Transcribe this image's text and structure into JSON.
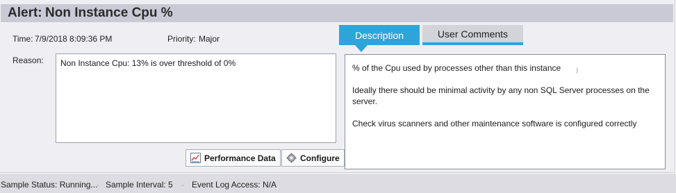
{
  "alert": {
    "prefix": "Alert:",
    "name": "Non Instance Cpu %"
  },
  "details": {
    "time_label": "Time:",
    "time_value": "7/9/2018 8:09:36 PM",
    "priority_label": "Priority:",
    "priority_value": "Major",
    "reason_label": "Reason:",
    "reason_text": "Non Instance Cpu: 13% is over threshold of 0%"
  },
  "buttons": {
    "performance_data": "Performance Data",
    "configure": "Configure"
  },
  "tabs": [
    {
      "label": "Description",
      "active": true
    },
    {
      "label": "User Comments",
      "active": false
    }
  ],
  "description": {
    "para1": "% of the Cpu used by processes other than this instance",
    "para2": "Ideally there should be minimal activity by any non SQL Server processes on the server.",
    "para3": "Check virus scanners and other maintenance software is configured correctly"
  },
  "status": {
    "sample_status": "Sample Status: Running...",
    "sample_interval": "Sample Interval: 5",
    "event_log_access": "Event Log Access: N/A"
  },
  "colors": {
    "accent": "#2ea5d9",
    "title_bar": "#c9cad6",
    "panel": "#efeff3",
    "status_bar": "#dcdce2"
  },
  "icons": {
    "performance": "chart-icon",
    "configure": "gear-icon"
  }
}
